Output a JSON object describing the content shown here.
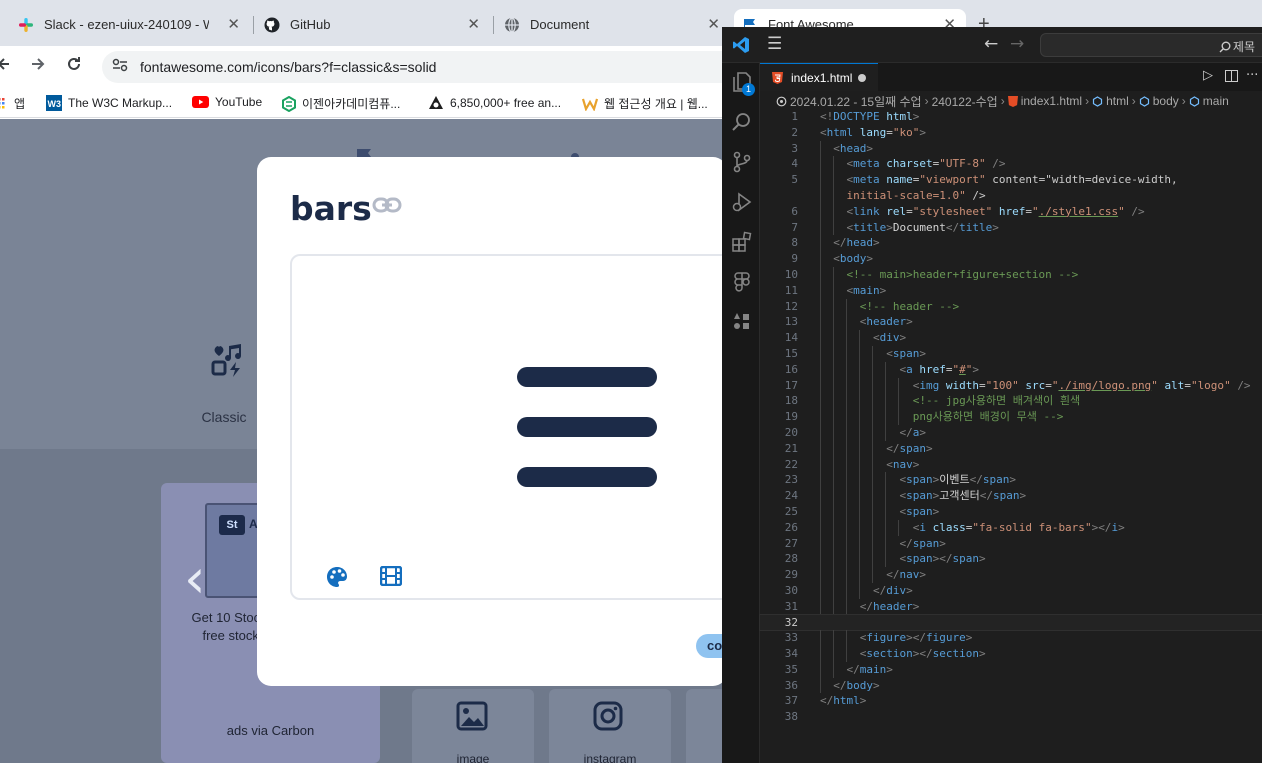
{
  "browser": {
    "tabs": [
      {
        "title": "Slack - ezen-uiux-240109 - W",
        "icon": "slack-icon"
      },
      {
        "title": "GitHub",
        "icon": "github-icon"
      },
      {
        "title": "Document",
        "icon": "globe-icon"
      },
      {
        "title": "Font Awesome",
        "icon": "fontawesome-icon"
      }
    ],
    "new_tab": "+",
    "close_glyph": "✕",
    "url": "fontawesome.com/icons/bars?f=classic&s=solid",
    "bookmarks": [
      {
        "label": "앱",
        "icon": "apps-grid-icon"
      },
      {
        "label": "The W3C Markup...",
        "icon": "w3c-icon"
      },
      {
        "label": "YouTube",
        "icon": "youtube-icon"
      },
      {
        "label": "이젠아카데미컴퓨...",
        "icon": "ezen-icon"
      },
      {
        "label": "6,850,000+ free an...",
        "icon": "flaticon-icon"
      },
      {
        "label": "웹 접근성 개요 | 웹...",
        "icon": "w-icon"
      }
    ]
  },
  "fontawesome_page": {
    "style_label": "Classic",
    "ad": {
      "badge": "St",
      "thumb_text": "Ad",
      "text": "Get 10 Stock p dow amazin free stock photos today.",
      "via": "ads via Carbon"
    },
    "icon_tiles": [
      {
        "label": "image",
        "icon": "image-icon"
      },
      {
        "label": "instagram",
        "icon": "instagram-icon"
      }
    ],
    "carousel_prev": "‹"
  },
  "modal": {
    "title": "bars",
    "copy_button": "co",
    "preview_icon": "bars-icon"
  },
  "vscode": {
    "search_label": "제목",
    "tab_filename": "index1.html",
    "activity_badge": "1",
    "breadcrumb": [
      "2024.01.22 - 15일째 수업",
      "240122-수업",
      "index1.html",
      "html",
      "body",
      "main"
    ],
    "current_line": 32,
    "code_lines": [
      "<!DOCTYPE html>",
      "<html lang=\"ko\">",
      "  <head>",
      "    <meta charset=\"UTF-8\" />",
      "    <meta name=\"viewport\" content=\"width=device-width,",
      "    initial-scale=1.0\" />",
      "    <link rel=\"stylesheet\" href=\"./style1.css\" />",
      "    <title>Document</title>",
      "  </head>",
      "  <body>",
      "    <!-- main>header+figure+section -->",
      "    <main>",
      "      <!-- header -->",
      "      <header>",
      "        <div>",
      "          <span>",
      "            <a href=\"#\">",
      "              <img width=\"100\" src=\"./img/logo.png\" alt=\"logo\" />",
      "              <!-- jpg사용하면 배겨색이 흰색",
      "              png사용하면 배경이 무색 -->",
      "            </a>",
      "          </span>",
      "          <nav>",
      "            <span>이벤트</span>",
      "            <span>고객센터</span>",
      "            <span>",
      "              <i class=\"fa-solid fa-bars\"></i>",
      "            </span>",
      "            <span></span>",
      "          </nav>",
      "        </div>",
      "      </header>",
      "",
      "      <figure></figure>",
      "      <section></section>",
      "    </main>",
      "  </body>",
      "</html>",
      ""
    ],
    "line_numbers": [
      "1",
      "2",
      "3",
      "4",
      "5",
      "",
      "6",
      "7",
      "8",
      "9",
      "10",
      "11",
      "12",
      "13",
      "14",
      "15",
      "16",
      "17",
      "18",
      "19",
      "20",
      "21",
      "22",
      "23",
      "24",
      "25",
      "26",
      "27",
      "28",
      "29",
      "30",
      "31",
      "32",
      "33",
      "34",
      "35",
      "36",
      "37",
      "38"
    ]
  }
}
